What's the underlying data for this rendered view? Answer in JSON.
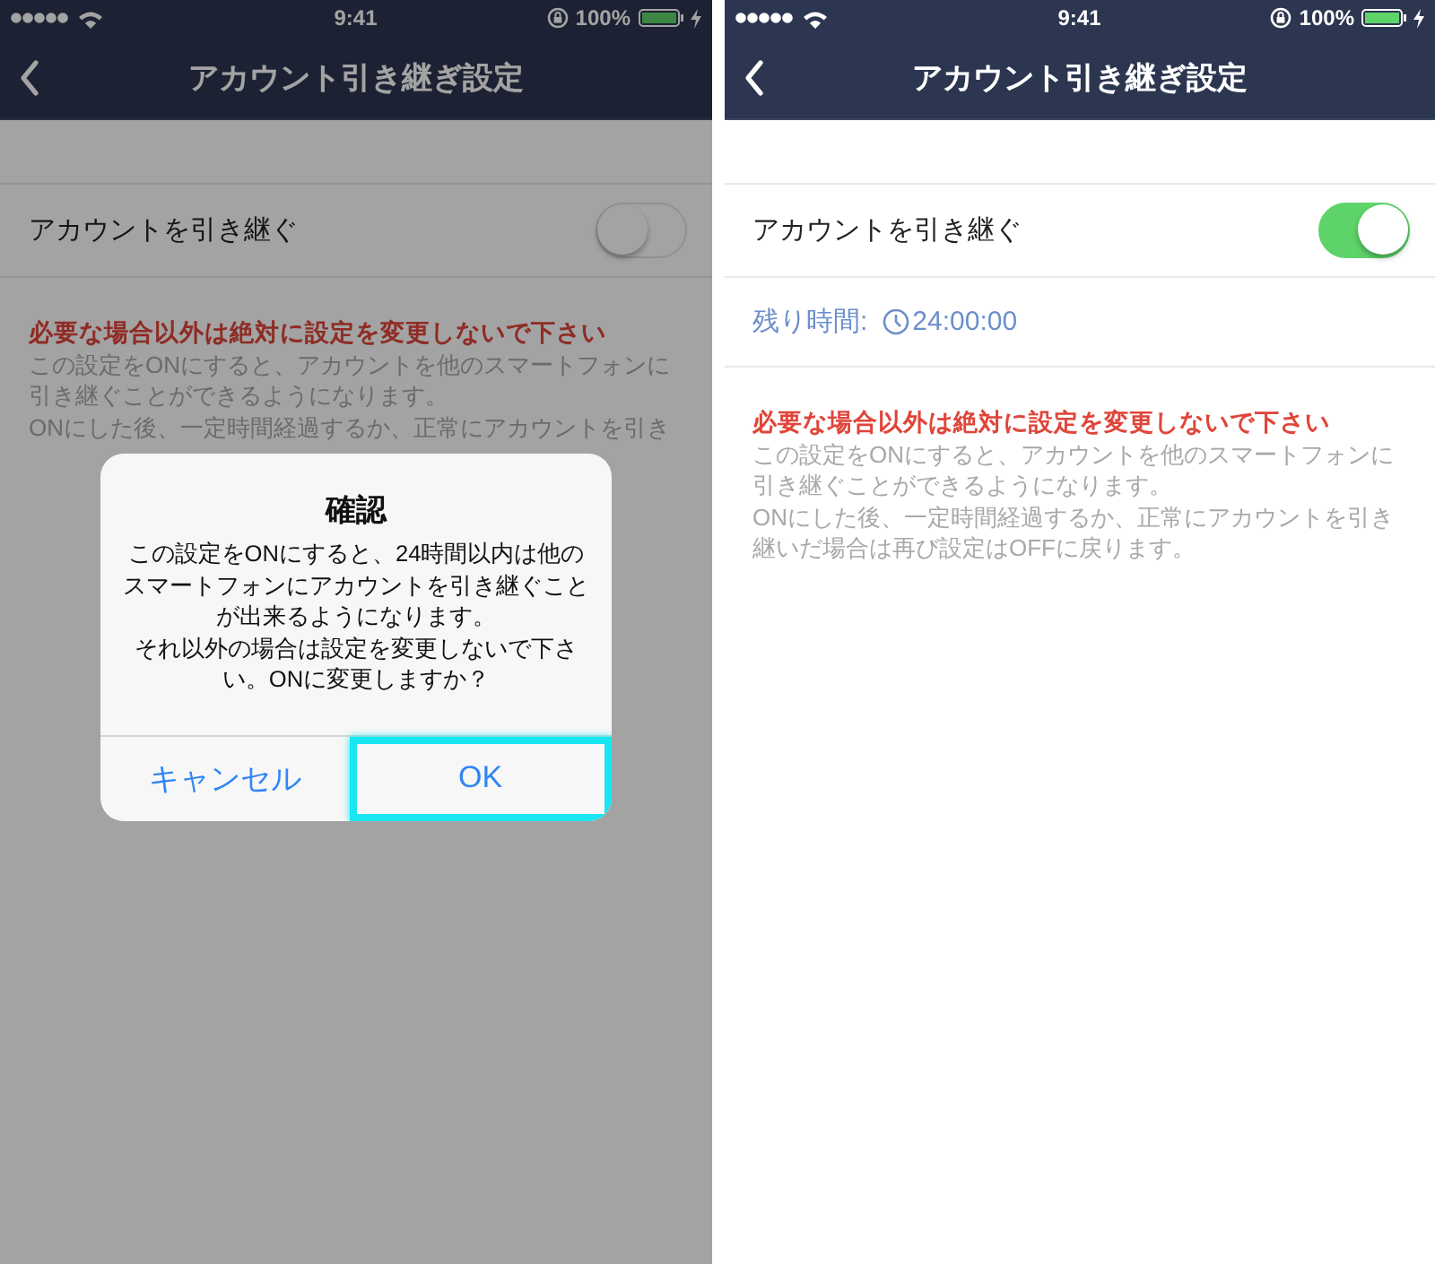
{
  "screens": [
    {
      "status_bar": {
        "time": "9:41",
        "battery": "100%"
      },
      "nav": {
        "title": "アカウント引き継ぎ設定"
      },
      "setting": {
        "label": "アカウントを引き継ぐ",
        "on": false
      },
      "warning": "必要な場合以外は絶対に設定を変更しないで下さい",
      "description": [
        "この設定をONにすると、アカウントを他のスマートフォンに引き継ぐことができるようになります。",
        "ONにした後、一定時間経過するか、正常にアカウントを引き"
      ],
      "dimmed": true,
      "dialog": {
        "title": "確認",
        "message": [
          "この設定をONにすると、24時間以内は他のスマートフォンにアカウントを引き継ぐことが出来るようになります。",
          "それ以外の場合は設定を変更しないで下さい。ONに変更しますか？"
        ],
        "buttons": [
          {
            "label": "キャンセル",
            "highlighted": false
          },
          {
            "label": "OK",
            "highlighted": true
          }
        ]
      }
    },
    {
      "status_bar": {
        "time": "9:41",
        "battery": "100%"
      },
      "nav": {
        "title": "アカウント引き継ぎ設定"
      },
      "setting": {
        "label": "アカウントを引き継ぐ",
        "on": true
      },
      "remaining": {
        "label": "残り時間:",
        "value": "24:00:00"
      },
      "warning": "必要な場合以外は絶対に設定を変更しないで下さい",
      "description": [
        "この設定をONにすると、アカウントを他のスマートフォンに引き継ぐことができるようになります。",
        "ONにした後、一定時間経過するか、正常にアカウントを引き継いだ場合は再び設定はOFFに戻ります。"
      ]
    }
  ]
}
